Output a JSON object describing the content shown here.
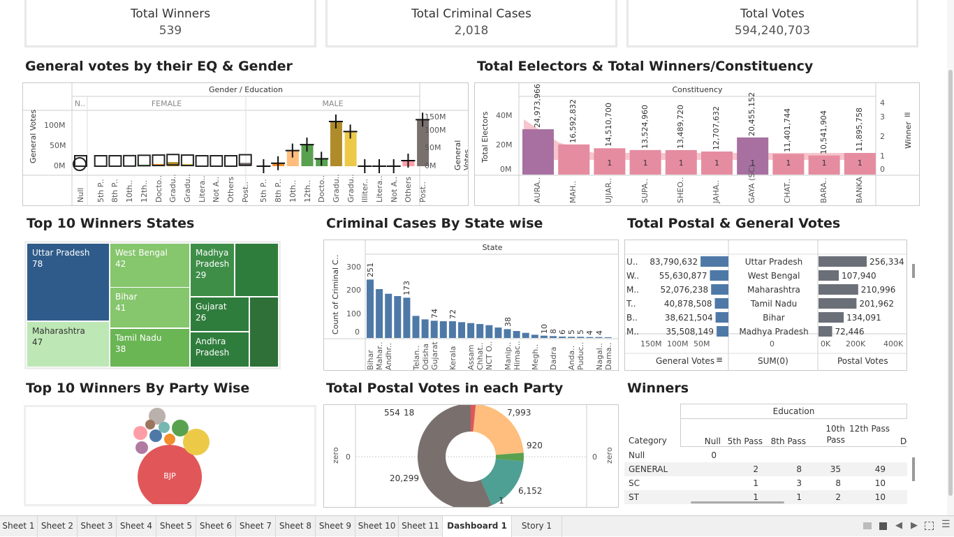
{
  "kpis": [
    {
      "title": "Total Winners",
      "value": "539"
    },
    {
      "title": "Total Criminal Cases",
      "value": "2,018"
    },
    {
      "title": "Total Votes",
      "value": "594,240,703"
    }
  ],
  "titles": {
    "eq_gender": "General votes by their EQ & Gender",
    "electors": "Total Eelectors & Total Winners/Constituency",
    "top_states": "Top 10 Winners States",
    "criminal": "Criminal Cases By State wise",
    "postal_general": "Total Postal  & General Votes",
    "party": "Top 10 Winners By Party Wise",
    "postal_party": "Total Postal Votes in each Party",
    "winners": "Winners"
  },
  "eq_chart": {
    "header": "Gender / Education",
    "groups": [
      "N..",
      "FEMALE",
      "MALE"
    ],
    "ylabel": "General Votes",
    "y2label": "General Votes",
    "yticks": [
      "100M",
      "50M",
      "0M"
    ],
    "y2ticks": [
      "150M",
      "100M",
      "50M",
      "0M"
    ],
    "categories": [
      "Null",
      "5th P..",
      "8th P..",
      "10th..",
      "12th..",
      "Docto..",
      "Gradu..",
      "Gradu..",
      "Litera..",
      "Not A..",
      "Others",
      "Post..",
      "5th P..",
      "8th P..",
      "10th..",
      "12th..",
      "Docto..",
      "Gradu..",
      "Gradu..",
      "Illiter..",
      "Litera..",
      "Not A..",
      "Others",
      "Post.."
    ]
  },
  "chart_data": [
    {
      "type": "bar",
      "title": "General votes by their EQ & Gender",
      "ylabel": "General Votes",
      "categories": [
        "Null",
        "F 5th Pass",
        "F 8th Pass",
        "F 10th Pass",
        "F 12th Pass",
        "F Doctorate",
        "F Graduate",
        "F Graduate Prof.",
        "F Literate",
        "F Not Available",
        "F Others",
        "F Post Graduate",
        "M 5th Pass",
        "M 8th Pass",
        "M 10th Pass",
        "M 12th Pass",
        "M Doctorate",
        "M Graduate",
        "M Graduate Prof.",
        "M Illiterate",
        "M Literate",
        "M Not Available",
        "M Others",
        "M Post Graduate"
      ],
      "values": [
        0,
        0,
        0,
        1,
        4,
        6,
        11,
        6,
        0,
        0,
        0,
        9,
        0,
        8,
        42,
        58,
        20,
        120,
        93,
        0,
        0,
        0,
        15,
        125
      ],
      "ylim": [
        0,
        150
      ]
    },
    {
      "type": "bar",
      "title": "Total Eelectors & Total Winners/Constituency",
      "ylabel": "Total Electors",
      "y2label": "Winner",
      "categories": [
        "AURA..",
        "MAH..",
        "UJIAR..",
        "SUPA..",
        "SHEO..",
        "JAHA..",
        "GAYA (SC)",
        "CHAT..",
        "BARA..",
        "BANKA"
      ],
      "values": [
        24973966,
        16592832,
        14510700,
        13524960,
        13489720,
        12707632,
        20455152,
        11401744,
        10541904,
        11895758
      ],
      "winners": [
        2,
        2,
        1,
        1,
        1,
        1,
        1,
        1,
        1,
        1
      ],
      "bar_labels": [
        "24,973,966",
        "16,592,832",
        "14,510,700",
        "13,524,960",
        "13,489,720",
        "12,707,632",
        "20,455,152",
        "11,401,744",
        "10,541,904",
        "11,895,758"
      ]
    },
    {
      "type": "bar",
      "title": "Criminal Cases By State wise",
      "ylabel": "Count of Criminal C..",
      "xlabel": "State",
      "categories": [
        "Bihar",
        "Mahar..",
        "Andhr..",
        "",
        "",
        "Telan..",
        "Odisha",
        "Gujarat",
        "",
        "Kerala",
        "",
        "Assam",
        "Chhat..",
        "NCT O..",
        "",
        "Manip..",
        "Himac..",
        "",
        "Megh..",
        "",
        "Dadra",
        "",
        "Anda..",
        "Puduc..",
        "",
        "Nagal..",
        "Dama.."
      ],
      "values": [
        251,
        210,
        190,
        180,
        173,
        95,
        80,
        74,
        72,
        72,
        68,
        64,
        60,
        55,
        45,
        38,
        30,
        22,
        14,
        10,
        8,
        6,
        5,
        5,
        4,
        4,
        3
      ],
      "ylim": [
        0,
        300
      ]
    },
    {
      "type": "pie",
      "title": "Total Postal Votes in each Party",
      "labels": [
        "554",
        "18",
        "7,993",
        "920",
        "6,152",
        "1",
        "20,299"
      ],
      "values": [
        554,
        18,
        7993,
        920,
        6152,
        1,
        20299
      ],
      "colors": [
        "#e15759",
        "#b07aa1",
        "#ffbe7d",
        "#59a14f",
        "#4e9f94",
        "#4e9f94",
        "#79706e"
      ]
    }
  ],
  "electors": {
    "header": "Constituency",
    "ylabel": "Total Electors",
    "yticks": [
      "40M",
      "20M",
      "0M"
    ],
    "y2label": "Winner",
    "y2ticks": [
      "4",
      "3",
      "2",
      "1",
      "0"
    ]
  },
  "criminal": {
    "header": "State",
    "yticks": [
      "300",
      "200",
      "100",
      "0"
    ],
    "labels": {
      "0": "251",
      "4": "173",
      "7": "74",
      "9": "72",
      "15": "38",
      "19": "10",
      "20": "8",
      "21": "6",
      "22": "5",
      "23": "5",
      "24": "4",
      "25": "4"
    }
  },
  "treemap": [
    {
      "name": "Uttar Pradesh",
      "value": "78"
    },
    {
      "name": "West Bengal",
      "value": "42"
    },
    {
      "name": "Madhya Pradesh",
      "value": "29"
    },
    {
      "name": "Bihar",
      "value": "41"
    },
    {
      "name": "Gujarat",
      "value": "26"
    },
    {
      "name": "Maharashtra",
      "value": "47"
    },
    {
      "name": "Tamil Nadu",
      "value": "38"
    },
    {
      "name": "Andhra Pradesh",
      "value": ""
    }
  ],
  "postal_general": {
    "rows": [
      {
        "abbr": "U..",
        "general": "83,790,632",
        "general_v": 83790632,
        "state": "Uttar Pradesh",
        "postal": "256,334",
        "postal_v": 256334
      },
      {
        "abbr": "W..",
        "general": "55,630,877",
        "general_v": 55630877,
        "state": "West Bengal",
        "postal": "107,940",
        "postal_v": 107940
      },
      {
        "abbr": "M..",
        "general": "52,076,238",
        "general_v": 52076238,
        "state": "Maharashtra",
        "postal": "210,996",
        "postal_v": 210996
      },
      {
        "abbr": "T..",
        "general": "40,878,508",
        "general_v": 40878508,
        "state": "Tamil Nadu",
        "postal": "201,962",
        "postal_v": 201962
      },
      {
        "abbr": "B..",
        "general": "38,621,504",
        "general_v": 38621504,
        "state": "Bihar",
        "postal": "134,091",
        "postal_v": 134091
      },
      {
        "abbr": "M..",
        "general": "35,508,149",
        "general_v": 35508149,
        "state": "Madhya Pradesh",
        "postal": "72,446",
        "postal_v": 72446
      }
    ],
    "gen_ticks": [
      "150M",
      "100M",
      "50M"
    ],
    "mid_tick": "0",
    "postal_ticks": [
      "0K",
      "200K",
      "400K"
    ],
    "col1": "General Votes",
    "col2": "SUM(0)",
    "col3": "Postal Votes"
  },
  "party": {
    "big_label": "BJP"
  },
  "postal_party": {
    "left_axis": "zero",
    "left_tick": "0",
    "right_axis": "zero",
    "right_tick": "0"
  },
  "winners_table": {
    "header": "Education",
    "category_label": "Category",
    "columns": [
      "Null",
      "5th Pass",
      "8th Pass",
      "10th Pass",
      "12th Pass",
      "Doc"
    ],
    "rows": [
      {
        "cat": "Null",
        "vals": [
          "0",
          "",
          "",
          "",
          "",
          ""
        ]
      },
      {
        "cat": "GENERAL",
        "vals": [
          "",
          "2",
          "8",
          "35",
          "49",
          ""
        ]
      },
      {
        "cat": "SC",
        "vals": [
          "",
          "1",
          "3",
          "8",
          "10",
          ""
        ]
      },
      {
        "cat": "ST",
        "vals": [
          "",
          "1",
          "1",
          "2",
          "10",
          ""
        ]
      }
    ]
  },
  "tabs": [
    "Sheet 1",
    "Sheet 2",
    "Sheet 3",
    "Sheet 4",
    "Sheet 5",
    "Sheet 6",
    "Sheet 7",
    "Sheet 8",
    "Sheet 9",
    "Sheet 10",
    "Sheet 11",
    "Dashboard 1",
    "Story 1"
  ],
  "active_tab": "Dashboard 1"
}
